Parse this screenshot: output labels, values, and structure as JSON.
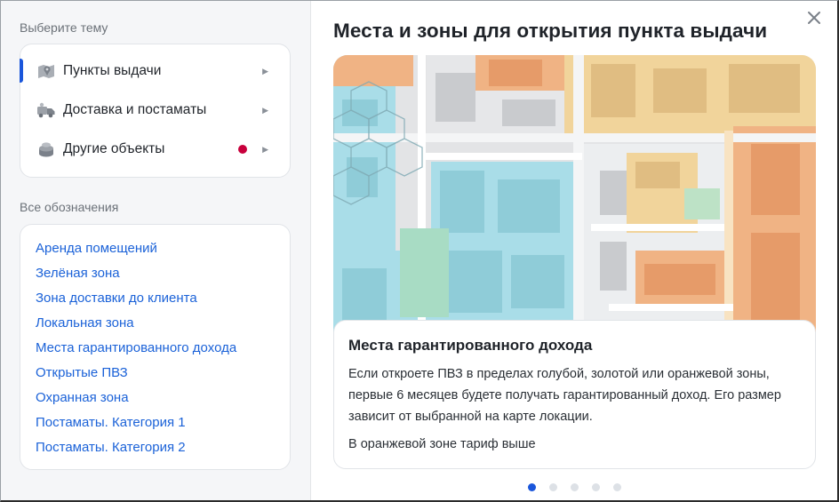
{
  "left": {
    "topics_heading": "Выберите тему",
    "topics": [
      {
        "label": "Пункты выдачи",
        "icon": "map-pin-icon",
        "active": true,
        "badge": false
      },
      {
        "label": "Доставка и постаматы",
        "icon": "delivery-truck-icon",
        "active": false,
        "badge": false
      },
      {
        "label": "Другие объекты",
        "icon": "stack-icon",
        "active": false,
        "badge": true
      }
    ],
    "legend_heading": "Все обозначения",
    "legend": [
      "Аренда помещений",
      "Зелёная зона",
      "Зона доставки до клиента",
      "Локальная зона",
      "Места гарантированного дохода",
      "Открытые ПВЗ",
      "Охранная зона",
      "Постаматы. Категория 1",
      "Постаматы. Категория 2"
    ]
  },
  "main": {
    "title": "Места и зоны для открытия пункта выдачи",
    "card": {
      "title": "Места гарантированного дохода",
      "text": "Если откроете ПВЗ в пределах голубой, золотой или оранжевой зоны, первые 6 месяцев будете получать гарантированный доход. Его размер зависит от выбранной на карте локации.",
      "note": "В оранжевой зоне тариф выше"
    },
    "slides_total": 5,
    "slide_active": 1
  },
  "colors": {
    "accent": "#1a56db",
    "link": "#1b62d8",
    "badge": "#c8003c",
    "zone_blue": "#a9dde8",
    "zone_gold": "#f1d49b",
    "zone_orange": "#f0b384"
  }
}
